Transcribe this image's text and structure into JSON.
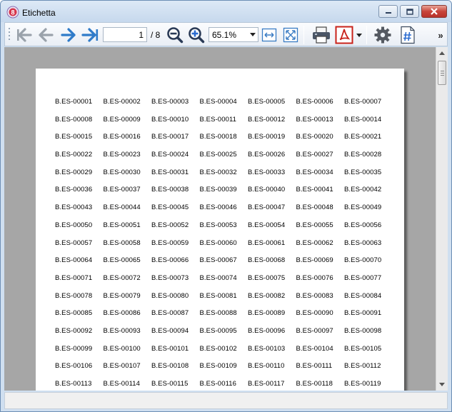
{
  "window": {
    "title": "Etichetta"
  },
  "toolbar": {
    "current_page": "1",
    "page_total": "/ 8",
    "zoom": "65.1%",
    "more": "»",
    "icons": [
      "first-page-icon",
      "previous-page-icon",
      "next-page-icon",
      "last-page-icon",
      "zoom-out-icon",
      "zoom-in-icon",
      "fit-width-icon",
      "fit-page-icon",
      "print-icon",
      "pdf-export-icon",
      "export-dropdown-icon",
      "settings-icon",
      "page-numbering-icon"
    ]
  },
  "colors": {
    "nav_disabled": "#9aa2ab",
    "nav_active": "#2f7bc9",
    "zoom_icon": "#2a3a56",
    "pdf_red": "#c8221a",
    "close_red": "#c8443a",
    "viewport_gray": "#a6a6a6"
  },
  "document": {
    "labels": [
      "B.ES-00001",
      "B.ES-00002",
      "B.ES-00003",
      "B.ES-00004",
      "B.ES-00005",
      "B.ES-00006",
      "B.ES-00007",
      "B.ES-00008",
      "B.ES-00009",
      "B.ES-00010",
      "B.ES-00011",
      "B.ES-00012",
      "B.ES-00013",
      "B.ES-00014",
      "B.ES-00015",
      "B.ES-00016",
      "B.ES-00017",
      "B.ES-00018",
      "B.ES-00019",
      "B.ES-00020",
      "B.ES-00021",
      "B.ES-00022",
      "B.ES-00023",
      "B.ES-00024",
      "B.ES-00025",
      "B.ES-00026",
      "B.ES-00027",
      "B.ES-00028",
      "B.ES-00029",
      "B.ES-00030",
      "B.ES-00031",
      "B.ES-00032",
      "B.ES-00033",
      "B.ES-00034",
      "B.ES-00035",
      "B.ES-00036",
      "B.ES-00037",
      "B.ES-00038",
      "B.ES-00039",
      "B.ES-00040",
      "B.ES-00041",
      "B.ES-00042",
      "B.ES-00043",
      "B.ES-00044",
      "B.ES-00045",
      "B.ES-00046",
      "B.ES-00047",
      "B.ES-00048",
      "B.ES-00049",
      "B.ES-00050",
      "B.ES-00051",
      "B.ES-00052",
      "B.ES-00053",
      "B.ES-00054",
      "B.ES-00055",
      "B.ES-00056",
      "B.ES-00057",
      "B.ES-00058",
      "B.ES-00059",
      "B.ES-00060",
      "B.ES-00061",
      "B.ES-00062",
      "B.ES-00063",
      "B.ES-00064",
      "B.ES-00065",
      "B.ES-00066",
      "B.ES-00067",
      "B.ES-00068",
      "B.ES-00069",
      "B.ES-00070",
      "B.ES-00071",
      "B.ES-00072",
      "B.ES-00073",
      "B.ES-00074",
      "B.ES-00075",
      "B.ES-00076",
      "B.ES-00077",
      "B.ES-00078",
      "B.ES-00079",
      "B.ES-00080",
      "B.ES-00081",
      "B.ES-00082",
      "B.ES-00083",
      "B.ES-00084",
      "B.ES-00085",
      "B.ES-00086",
      "B.ES-00087",
      "B.ES-00088",
      "B.ES-00089",
      "B.ES-00090",
      "B.ES-00091",
      "B.ES-00092",
      "B.ES-00093",
      "B.ES-00094",
      "B.ES-00095",
      "B.ES-00096",
      "B.ES-00097",
      "B.ES-00098",
      "B.ES-00099",
      "B.ES-00100",
      "B.ES-00101",
      "B.ES-00102",
      "B.ES-00103",
      "B.ES-00104",
      "B.ES-00105",
      "B.ES-00106",
      "B.ES-00107",
      "B.ES-00108",
      "B.ES-00109",
      "B.ES-00110",
      "B.ES-00111",
      "B.ES-00112",
      "B.ES-00113",
      "B.ES-00114",
      "B.ES-00115",
      "B.ES-00116",
      "B.ES-00117",
      "B.ES-00118",
      "B.ES-00119"
    ]
  }
}
